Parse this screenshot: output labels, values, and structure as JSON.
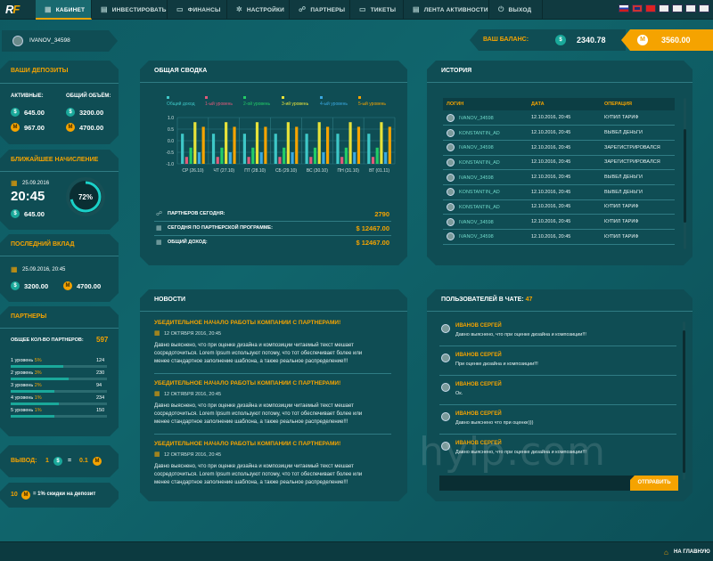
{
  "nav": {
    "logo": "RF",
    "items": [
      {
        "label": "КАБИНЕТ",
        "icon": "grid-icon"
      },
      {
        "label": "ИНВЕСТИРОВАТЬ",
        "icon": "wallet-icon"
      },
      {
        "label": "ФИНАНСЫ",
        "icon": "card-icon"
      },
      {
        "label": "НАСТРОЙКИ",
        "icon": "gear-icon"
      },
      {
        "label": "ПАРТНЕРЫ",
        "icon": "users-icon"
      },
      {
        "label": "ТИКЕТЫ",
        "icon": "ticket-icon"
      },
      {
        "label": "ЛЕНТА АКТИВНОСТИ",
        "icon": "feed-icon"
      },
      {
        "label": "ВЫХОД",
        "icon": "power-icon"
      }
    ],
    "active": 0,
    "flags": [
      "ru",
      "gb",
      "cn",
      "other",
      "other",
      "other",
      "other"
    ]
  },
  "user": {
    "name": "IVANOV_34598"
  },
  "balance": {
    "label": "ВАШ БАЛАНС:",
    "usd": "2340.78",
    "coin": "3560.00"
  },
  "deposits": {
    "title": "ВАШИ ДЕПОЗИТЫ",
    "active_label": "АКТИВНЫЕ:",
    "total_label": "ОБЩИЙ ОБЪЁМ:",
    "active_usd": "645.00",
    "active_coin": "967.00",
    "total_usd": "3200.00",
    "total_coin": "4700.00"
  },
  "next_accrual": {
    "title": "БЛИЖАЙШЕЕ НАЧИСЛЕНИЕ",
    "date": "25.09.2016",
    "time": "20:45",
    "amount": "645.00",
    "percent_text": "72%",
    "percent": 72
  },
  "last_deposit": {
    "title": "ПОСЛЕДНИЙ ВКЛАД",
    "datetime": "25.09.2016, 20:45",
    "usd": "3200.00",
    "coin": "4700.00"
  },
  "partners": {
    "title": "ПАРТНЕРЫ",
    "total_label": "ОБЩЕЕ КОЛ-ВО ПАРТНЕРОВ:",
    "total": "597",
    "levels": [
      {
        "label": "1 уровень",
        "pct": "5%",
        "count": "124",
        "fill": 0.55
      },
      {
        "label": "2 уровень",
        "pct": "3%",
        "count": "230",
        "fill": 0.6
      },
      {
        "label": "3 уровень",
        "pct": "2%",
        "count": "94",
        "fill": 0.45
      },
      {
        "label": "4 уровень",
        "pct": "1%",
        "count": "234",
        "fill": 0.5
      },
      {
        "label": "5 уровень",
        "pct": "1%",
        "count": "150",
        "fill": 0.45
      }
    ]
  },
  "withdraw": {
    "label": "ВЫВОД:",
    "left": "1",
    "eq": "=",
    "right": "0.1"
  },
  "discount": {
    "count": "10",
    "text": "= 1% скидки на депозит"
  },
  "summary": {
    "title": "ОБЩАЯ СВОДКА",
    "rows": [
      {
        "label": "ПАРТНЕРОВ СЕГОДНЯ:",
        "value": "2790"
      },
      {
        "label": "СЕГОДНЯ ПО ПАРТНЕРСКОЙ ПРОГРАММЕ:",
        "value": "$ 12467.00"
      },
      {
        "label": "ОБЩИЙ ДОХОД:",
        "value": "$ 12467.00"
      }
    ]
  },
  "chart_data": {
    "type": "bar",
    "categories": [
      "СР (26.10)",
      "ЧТ (27.10)",
      "ПТ (28.10)",
      "СБ (29.10)",
      "ВС (30.10)",
      "ПН (31.10)",
      "ВТ (01.11)"
    ],
    "yticks": [
      "1.0",
      "0.5",
      "0.0",
      "-0.5",
      "-1.0"
    ],
    "ylim": [
      -1.0,
      1.0
    ],
    "grid": true,
    "legend_position": "top",
    "series": [
      {
        "name": "Общий доход",
        "color": "#3ec8c8",
        "values": [
          0.3,
          0.3,
          0.3,
          0.3,
          0.3,
          0.3,
          0.3
        ]
      },
      {
        "name": "1-ый уровень",
        "color": "#e05a7a",
        "values": [
          -0.7,
          -0.7,
          -0.7,
          -0.7,
          -0.7,
          -0.7,
          -0.7
        ]
      },
      {
        "name": "2-ой уровень",
        "color": "#22cc66",
        "values": [
          -0.3,
          -0.3,
          -0.3,
          -0.3,
          -0.3,
          -0.3,
          -0.3
        ]
      },
      {
        "name": "3-ий уровень",
        "color": "#e6e23a",
        "values": [
          0.8,
          0.8,
          0.8,
          0.8,
          0.8,
          0.8,
          0.8
        ]
      },
      {
        "name": "4-ый уровень",
        "color": "#3aa8e0",
        "values": [
          -0.5,
          -0.5,
          -0.5,
          -0.5,
          -0.5,
          -0.5,
          -0.5
        ]
      },
      {
        "name": "5-ый уровень",
        "color": "#f5a300",
        "values": [
          0.6,
          0.6,
          0.6,
          0.6,
          0.6,
          0.6,
          0.6
        ]
      }
    ]
  },
  "history": {
    "title": "ИСТОРИЯ",
    "columns": [
      "ЛОГИН",
      "ДАТА",
      "ОПЕРАЦИЯ"
    ],
    "rows": [
      [
        "IVANOV_34598",
        "12.10.2016, 20:45",
        "КУПИЛ ТАРИФ"
      ],
      [
        "KONSTANTIN_AD",
        "12.10.2016, 20:45",
        "ВЫВЕЛ ДЕНЬГИ"
      ],
      [
        "IVANOV_34598",
        "12.10.2016, 20:45",
        "ЗАРЕГИСТРИРОВАЛСЯ"
      ],
      [
        "KONSTANTIN_AD",
        "12.10.2016, 20:45",
        "ЗАРЕГИСТРИРОВАЛСЯ"
      ],
      [
        "IVANOV_34598",
        "12.10.2016, 20:45",
        "ВЫВЕЛ ДЕНЬГИ"
      ],
      [
        "KONSTANTIN_AD",
        "12.10.2016, 20:45",
        "ВЫВЕЛ ДЕНЬГИ"
      ],
      [
        "KONSTANTIN_AD",
        "12.10.2016, 20:45",
        "КУПИЛ ТАРИФ"
      ],
      [
        "IVANOV_34598",
        "12.10.2016, 20:45",
        "КУПИЛ ТАРИФ"
      ],
      [
        "IVANOV_34598",
        "12.10.2016, 20:45",
        "КУПИЛ ТАРИФ"
      ]
    ]
  },
  "news": {
    "title": "НОВОСТИ",
    "items": [
      {
        "title": "УБЕДИТЕЛЬНОЕ НАЧАЛО РАБОТЫ КОМПАНИИ С ПАРТНЕРАМИ!",
        "date": "12 ОКТЯБРЯ 2016, 20:45",
        "body": "Давно выяснено, что при оценке дизайна и композиции читаемый текст мешает сосредоточиться. Lorem Ipsum используют потому, что тот обеспечивает более или менее стандартное заполнение шаблона, а также реальное распределение!!!"
      },
      {
        "title": "УБЕДИТЕЛЬНОЕ НАЧАЛО РАБОТЫ КОМПАНИИ С ПАРТНЕРАМИ!",
        "date": "12 ОКТЯБРЯ 2016, 20:45",
        "body": "Давно выяснено, что при оценке дизайна и композиции читаемый текст мешает сосредоточиться. Lorem Ipsum используют потому, что тот обеспечивает более или менее стандартное заполнение шаблона, а также реальное распределение!!!"
      },
      {
        "title": "УБЕДИТЕЛЬНОЕ НАЧАЛО РАБОТЫ КОМПАНИИ С ПАРТНЕРАМИ!",
        "date": "12 ОКТЯБРЯ 2016, 20:45",
        "body": "Давно выяснено, что при оценке дизайна и композиции читаемый текст мешает сосредоточиться. Lorem Ipsum используют потому, что тот обеспечивает более или менее стандартное заполнение шаблона, а также реальное распределение!!!"
      }
    ]
  },
  "chat": {
    "title": "ПОЛЬЗОВАТЕЛЕЙ В ЧАТЕ:",
    "count": "47",
    "messages": [
      {
        "name": "ИВАНОВ СЕРГЕЙ",
        "text": "Давно выяснено, что при оценке дизайна и композиции!!!"
      },
      {
        "name": "ИВАНОВ СЕРГЕЙ",
        "text": "При оценке дизайна и композиции!!!"
      },
      {
        "name": "ИВАНОВ СЕРГЕЙ",
        "text": "Ок."
      },
      {
        "name": "ИВАНОВ СЕРГЕЙ",
        "text": "Давно выяснено что при оценке)))"
      },
      {
        "name": "ИВАНОВ СЕРГЕЙ",
        "text": "Давно выяснено, что при оценке дизайна и композиции!!!"
      }
    ],
    "input_placeholder": "",
    "send_label": "ОТПРАВИТЬ"
  },
  "watermark": "hyip.com",
  "footer": {
    "home_label": "НА ГЛАВНУЮ"
  }
}
